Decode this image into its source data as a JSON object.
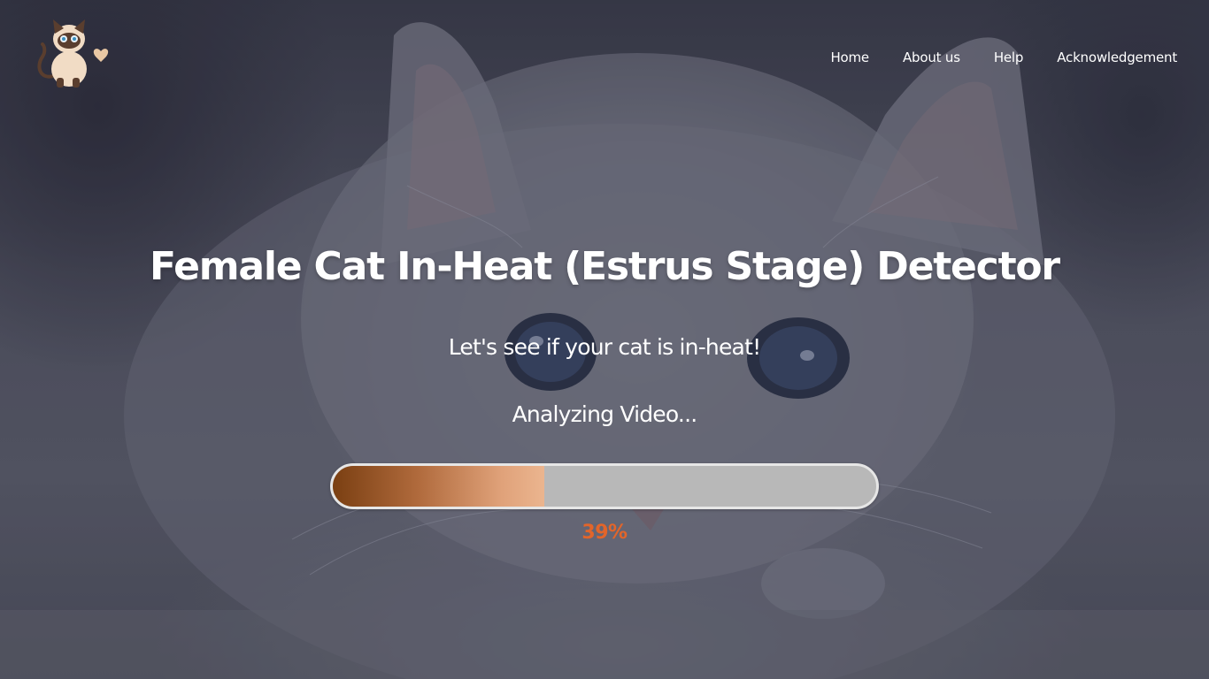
{
  "nav": {
    "items": [
      {
        "label": "Home"
      },
      {
        "label": "About us"
      },
      {
        "label": "Help"
      },
      {
        "label": "Acknowledgement"
      }
    ]
  },
  "logo": {
    "icon": "siamese-cat-with-heart-icon"
  },
  "hero": {
    "title": "Female Cat In-Heat (Estrus Stage) Detector",
    "subtitle": "Let's see if your cat is in-heat!",
    "status": "Analyzing Video...",
    "progress": {
      "percent": 39,
      "label": "39%"
    }
  },
  "colors": {
    "accent": "#e2652a",
    "progress_start": "#7a3f12",
    "progress_end": "#ebb58f",
    "track": "#b8b8b8"
  }
}
